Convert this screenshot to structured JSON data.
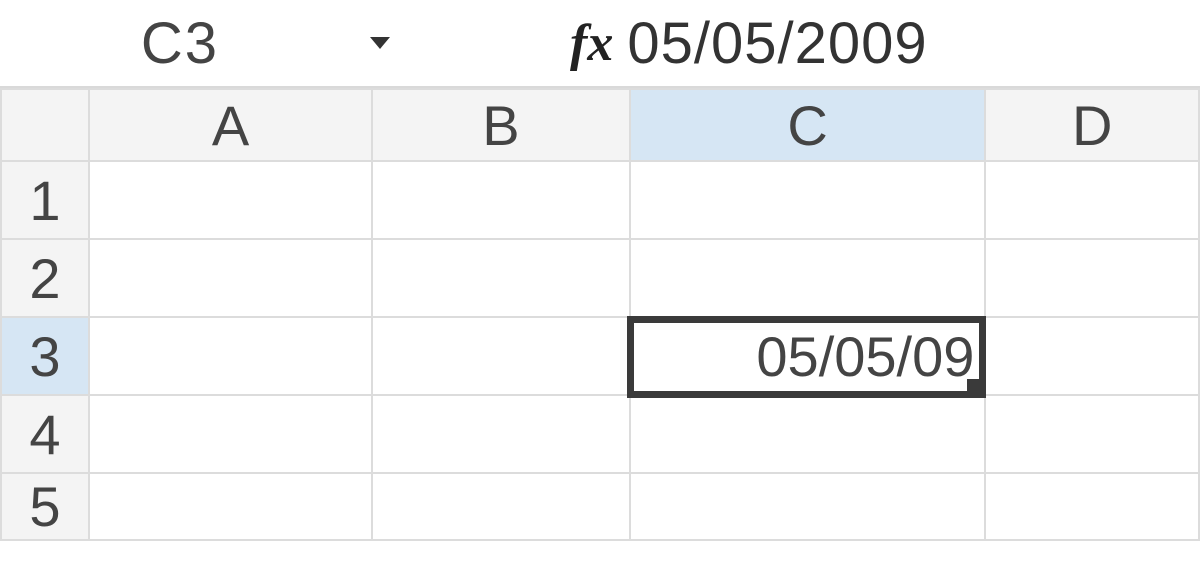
{
  "nameBox": {
    "value": "C3"
  },
  "formulaBar": {
    "fxLabel": "fx",
    "value": "05/05/2009"
  },
  "columns": [
    "A",
    "B",
    "C",
    "D"
  ],
  "rows": [
    "1",
    "2",
    "3",
    "4",
    "5"
  ],
  "selectedColumn": "C",
  "selectedRow": "3",
  "cells": {
    "C3": "05/05/09"
  }
}
